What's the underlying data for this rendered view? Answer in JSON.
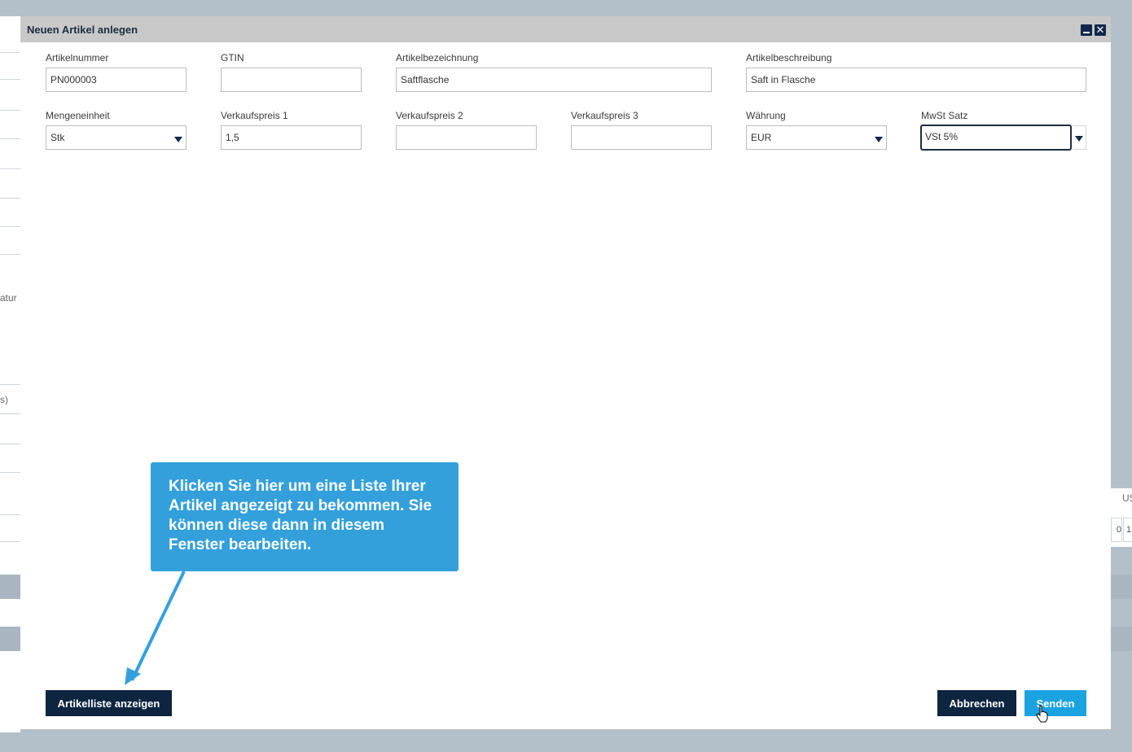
{
  "dialog": {
    "title": "Neuen Artikel anlegen"
  },
  "form": {
    "artikelnummer": {
      "label": "Artikelnummer",
      "value": "PN000003"
    },
    "gtin": {
      "label": "GTIN",
      "value": ""
    },
    "artikelbezeichnung": {
      "label": "Artikelbezeichnung",
      "value": "Saftflasche"
    },
    "artikelbeschreibung": {
      "label": "Artikelbeschreibung",
      "value": "Saft in Flasche"
    },
    "mengeneinheit": {
      "label": "Mengeneinheit",
      "value": "Stk"
    },
    "verkaufspreis1": {
      "label": "Verkaufspreis 1",
      "value": "1,5"
    },
    "verkaufspreis2": {
      "label": "Verkaufspreis 2",
      "value": ""
    },
    "verkaufspreis3": {
      "label": "Verkaufspreis 3",
      "value": ""
    },
    "waehrung": {
      "label": "Währung",
      "value": "EUR"
    },
    "mwst": {
      "label": "MwSt Satz",
      "value": "VSt 5%"
    }
  },
  "tooltip": {
    "text": "Klicken Sie hier um eine Liste Ihrer Artikel angezeigt zu bekommen. Sie können diese dann in diesem Fenster bearbeiten."
  },
  "buttons": {
    "artikelliste": "Artikelliste anzeigen",
    "abbrechen": "Abbrechen",
    "senden": "Senden"
  },
  "background": {
    "fragment_atur": "atur",
    "fragment_s": "s)",
    "fragment_us": "US",
    "fragment_box1": "0",
    "fragment_box2": "1"
  },
  "colors": {
    "tooltip": "#33a0dc",
    "primary_dark": "#0e2540",
    "primary_blue": "#1aa3e0",
    "titlebar": "#c8c8c8"
  },
  "icons": [
    "minimize-icon",
    "close-icon",
    "dropdown-caret-icon",
    "hand-pointer-icon"
  ]
}
